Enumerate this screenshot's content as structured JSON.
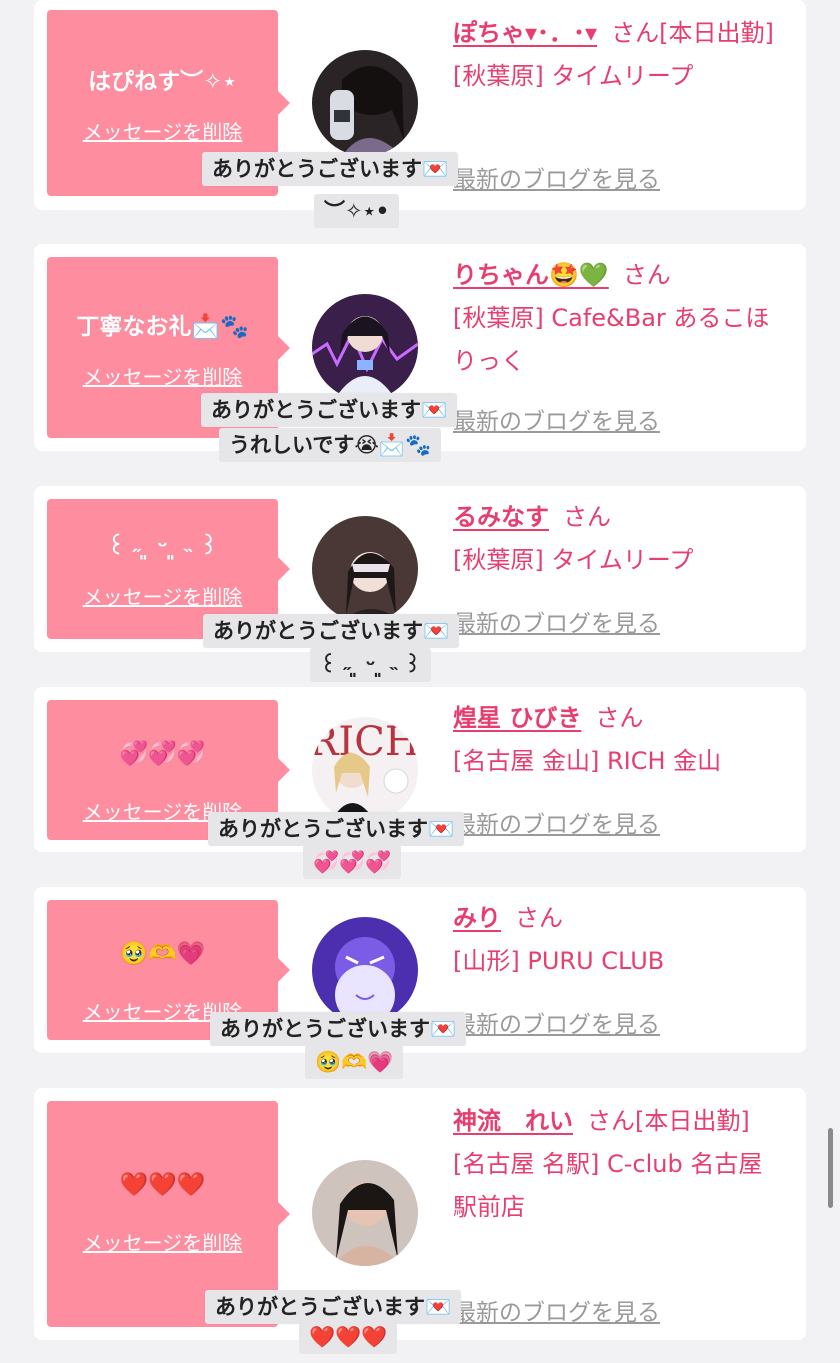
{
  "delete_label": "メッセージを削除",
  "san_label": "さん",
  "blog_label": "最新のブログを見る",
  "colors": {
    "accent": "#e83e6f",
    "bubble": "#fe8da0",
    "reply_bg": "#e6e6e8"
  },
  "entries": [
    {
      "message": "はぴねす︶✧⋆",
      "name": "ぽちゃ▾･．･▾",
      "status": "[本日出勤]",
      "shop": "[秋葉原] タイムリープ",
      "reply_line1": "ありがとうございます💌",
      "reply_line2": "︶✧⋆•"
    },
    {
      "message": "丁寧なお礼📩🐾",
      "name": "りちゃん🤩💚",
      "status": "",
      "shop": "[秋葉原] Cafe&Bar あるこほりっく",
      "reply_line1": "ありがとうございます💌",
      "reply_line2": "うれしいです😭📩🐾"
    },
    {
      "message": "꒰ ˶ ͈ ᵕ ͈ ˵ ꒱",
      "name": "るみなす",
      "status": "",
      "shop": "[秋葉原] タイムリープ",
      "reply_line1": "ありがとうございます💌",
      "reply_line2": "꒰ ˶ ͈ ᵕ ͈ ˵ ꒱"
    },
    {
      "message": "💞💞💞",
      "name": "煌星 ひびき",
      "status": "",
      "shop": "[名古屋 金山] RICH 金山",
      "reply_line1": "ありがとうございます💌",
      "reply_line2": "💞💞💞"
    },
    {
      "message": "🥹🫶💗",
      "name": "みり",
      "status": "",
      "shop": "[山形] PURU CLUB",
      "reply_line1": "ありがとうございます💌",
      "reply_line2": "🥹🫶💗"
    },
    {
      "message": "❤️❤️❤️",
      "name": "神流　れい",
      "status": "[本日出勤]",
      "shop": "[名古屋 名駅] C-club 名古屋駅前店",
      "reply_line1": "ありがとうございます💌",
      "reply_line2": "❤️❤️❤️"
    }
  ]
}
